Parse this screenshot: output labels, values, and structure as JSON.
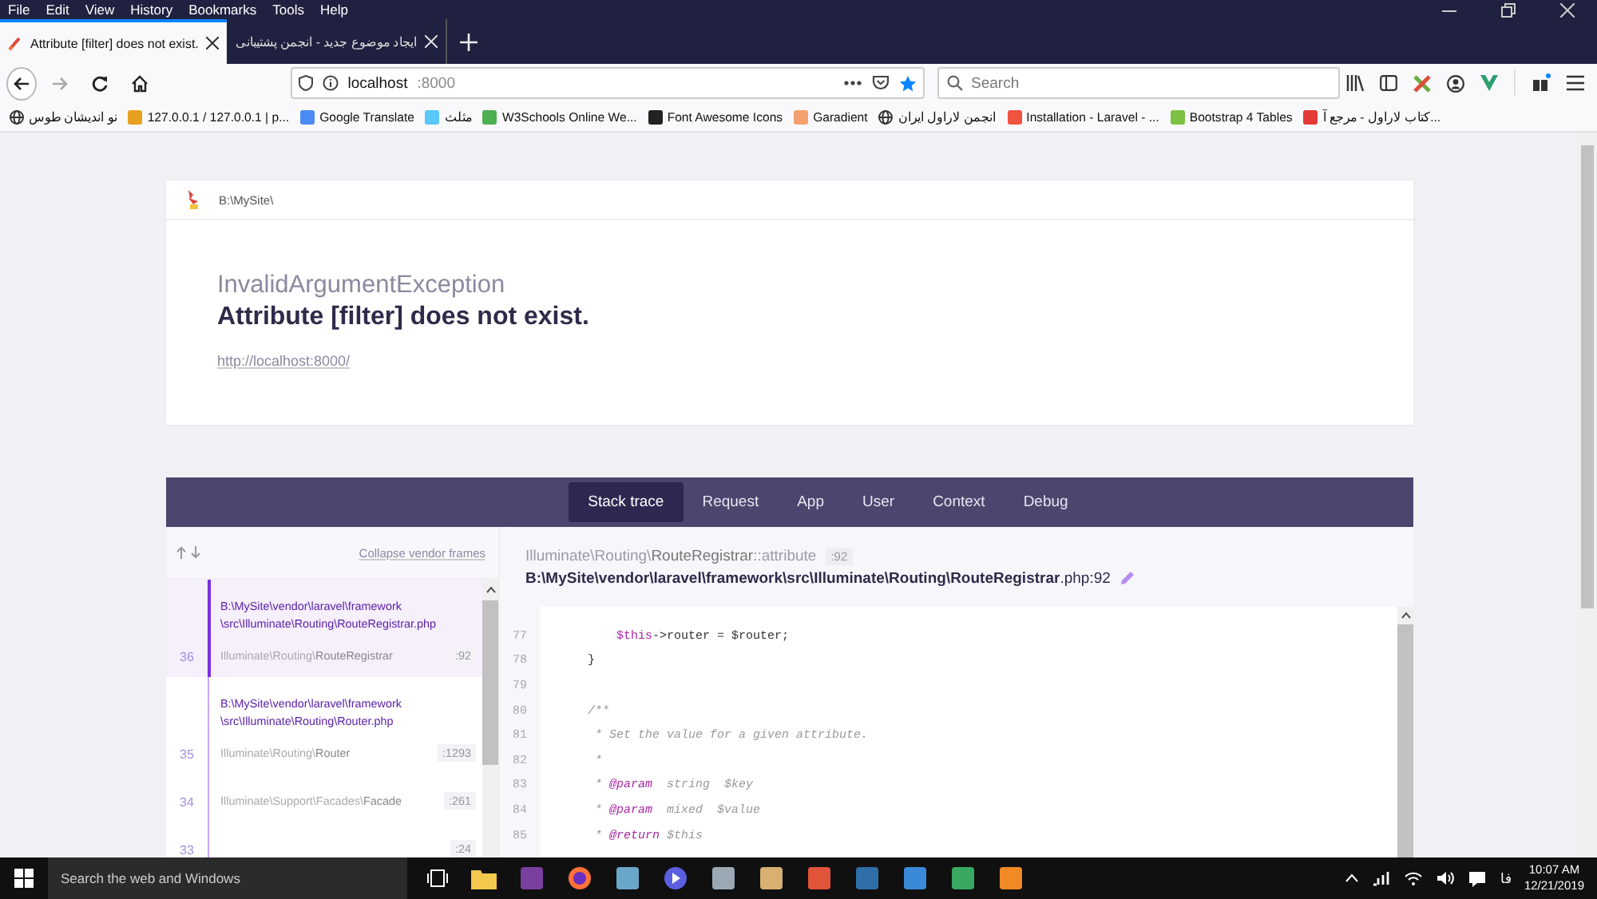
{
  "browser": {
    "menu": [
      "File",
      "Edit",
      "View",
      "History",
      "Bookmarks",
      "Tools",
      "Help"
    ],
    "tabs": [
      {
        "title": "Attribute [filter] does not exist.",
        "selected": true
      },
      {
        "title": "ایجاد موضوع جدید - انجمن پشتیبانی",
        "selected": false
      }
    ],
    "address": {
      "host": "localhost",
      "port": ":8000"
    },
    "search": {
      "placeholder": "Search"
    },
    "bookmarks": [
      {
        "label": "نو اندیشان طوس",
        "kind": "globe"
      },
      {
        "label": "127.0.0.1 / 127.0.0.1 | p...",
        "kind": "favicon",
        "color": "#e8a020"
      },
      {
        "label": "Google Translate",
        "kind": "favicon",
        "color": "#4a8af4"
      },
      {
        "label": "مثلث",
        "kind": "favicon",
        "color": "#5ac8fa"
      },
      {
        "label": "W3Schools Online We...",
        "kind": "favicon",
        "color": "#4caf50"
      },
      {
        "label": "Font Awesome Icons",
        "kind": "favicon",
        "color": "#222222"
      },
      {
        "label": "Garadient",
        "kind": "favicon",
        "color": "#f4a070"
      },
      {
        "label": "انجمن لاراول ایران",
        "kind": "globe"
      },
      {
        "label": "Installation - Laravel - ...",
        "kind": "favicon",
        "color": "#f05340"
      },
      {
        "label": "Bootstrap 4 Tables",
        "kind": "favicon",
        "color": "#7cc142"
      },
      {
        "label": "کتاب لاراول - مرجع آ...",
        "kind": "favicon",
        "color": "#e53935"
      }
    ]
  },
  "page": {
    "app_path": "B:\\MySite\\",
    "exception": "InvalidArgumentException",
    "message": "Attribute [filter] does not exist.",
    "url": "http://localhost:8000/",
    "nav": [
      {
        "label": "Stack trace",
        "selected": true
      },
      {
        "label": "Request",
        "selected": false
      },
      {
        "label": "App",
        "selected": false
      },
      {
        "label": "User",
        "selected": false
      },
      {
        "label": "Context",
        "selected": false
      },
      {
        "label": "Debug",
        "selected": false
      }
    ],
    "collapse_label": "Collapse vendor frames",
    "frames": [
      {
        "number": "36",
        "file_lines": [
          "B:\\MySite\\vendor\\laravel\\framework",
          "\\src\\Illuminate\\Routing\\RouteRegistrar.php"
        ],
        "namespace": "Illuminate\\Routing\\",
        "name": "RouteRegistrar",
        "line": ":92",
        "selected": true
      },
      {
        "number": "35",
        "file_lines": [
          "B:\\MySite\\vendor\\laravel\\framework",
          "\\src\\Illuminate\\Routing\\Router.php"
        ],
        "namespace": "Illuminate\\Routing\\",
        "name": "Router",
        "line": ":1293",
        "selected": false
      },
      {
        "number": "34",
        "namespace": "Illuminate\\Support\\Facades\\",
        "name": "Facade",
        "line": ":261",
        "selected": false
      },
      {
        "number": "33",
        "line": ":24",
        "selected": false
      }
    ],
    "detail": {
      "class_namespace": "Illuminate\\Routing\\",
      "class_name": "RouteRegistrar",
      "method": "::attribute",
      "line": ":92",
      "path": "**B:\\MySite\\vendor\\laravel\\framework\\src\\Illuminate\\Routing\\RouteRegistrar**.php:92",
      "code": [
        {
          "number": "77",
          "tokens": [
            {
              "kind": "var",
              "text": "        $this"
            },
            {
              "kind": "plain",
              "text": "->router = $router;"
            }
          ]
        },
        {
          "number": "78",
          "tokens": [
            {
              "kind": "plain",
              "text": "    }"
            }
          ]
        },
        {
          "number": "79"
        },
        {
          "number": "80",
          "tokens": [
            {
              "kind": "comment",
              "text": "    /**"
            }
          ]
        },
        {
          "number": "81",
          "tokens": [
            {
              "kind": "comment",
              "text": "     * Set the value for a given attribute."
            }
          ]
        },
        {
          "number": "82",
          "tokens": [
            {
              "kind": "comment",
              "text": "     *"
            }
          ]
        },
        {
          "number": "83",
          "tokens": [
            {
              "kind": "comment",
              "text": "     * "
            },
            {
              "kind": "tag",
              "text": "@param"
            },
            {
              "kind": "comment",
              "text": "  string  $key"
            }
          ]
        },
        {
          "number": "84",
          "tokens": [
            {
              "kind": "comment",
              "text": "     * "
            },
            {
              "kind": "tag",
              "text": "@param"
            },
            {
              "kind": "comment",
              "text": "  mixed  $value"
            }
          ]
        },
        {
          "number": "85",
          "tokens": [
            {
              "kind": "comment",
              "text": "     * "
            },
            {
              "kind": "tag",
              "text": "@return"
            },
            {
              "kind": "comment",
              "text": " $this"
            }
          ]
        }
      ]
    }
  },
  "taskbar": {
    "search_placeholder": "Search the web and Windows",
    "language": "فا",
    "time": "10:07 AM",
    "date": "12/21/2019"
  }
}
